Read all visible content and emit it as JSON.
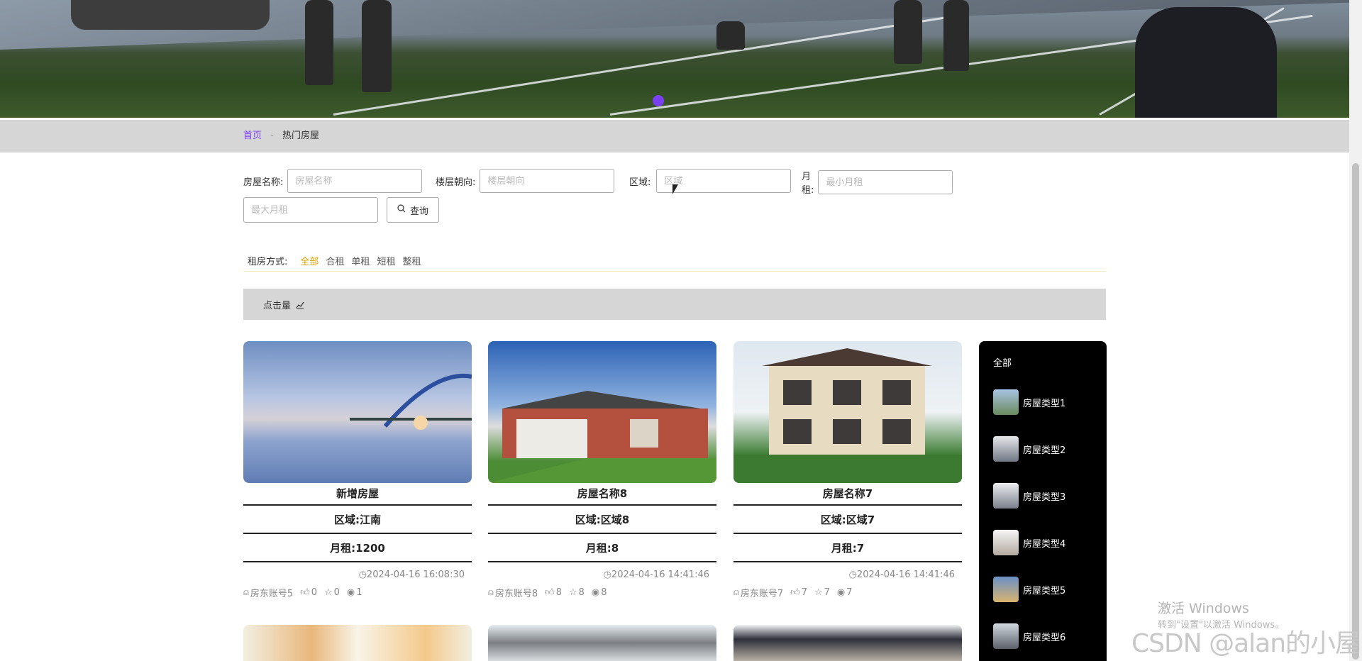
{
  "breadcrumb": {
    "home": "首页",
    "separator": "-",
    "current": "热门房屋"
  },
  "search": {
    "fields": [
      {
        "label": "房屋名称:",
        "placeholder": "房屋名称"
      },
      {
        "label": "楼层朝向:",
        "placeholder": "楼层朝向"
      },
      {
        "label": "区域:",
        "placeholder": "区域"
      },
      {
        "label": "月租:",
        "placeholder": "最小月租"
      },
      {
        "label": "",
        "placeholder": "最大月租"
      }
    ],
    "button_label": "查询"
  },
  "rent_mode": {
    "label": "租房方式:",
    "options": [
      "全部",
      "合租",
      "单租",
      "短租",
      "整租"
    ],
    "active": "全部"
  },
  "sort": {
    "label": "点击量"
  },
  "cards": [
    {
      "title": "新增房屋",
      "area": "区域:江南",
      "rent": "月租:1200",
      "date": "2024-04-16 16:08:30",
      "owner": "房东账号5",
      "likes": "0",
      "stars": "0",
      "views": "1"
    },
    {
      "title": "房屋名称8",
      "area": "区域:区域8",
      "rent": "月租:8",
      "date": "2024-04-16 14:41:46",
      "owner": "房东账号8",
      "likes": "8",
      "stars": "8",
      "views": "8"
    },
    {
      "title": "房屋名称7",
      "area": "区域:区域7",
      "rent": "月租:7",
      "date": "2024-04-16 14:41:46",
      "owner": "房东账号7",
      "likes": "7",
      "stars": "7",
      "views": "7"
    }
  ],
  "side": {
    "all": "全部",
    "items": [
      "房屋类型1",
      "房屋类型2",
      "房屋类型3",
      "房屋类型4",
      "房屋类型5",
      "房屋类型6"
    ]
  },
  "watermark": {
    "line1": "激活 Windows",
    "line2": "转到\"设置\"以激活 Windows。",
    "brand": "CSDN @alan的小屋"
  },
  "colors": {
    "accent": "#7b3ff2",
    "active_option": "#d8a300",
    "bar_gray": "#d6d6d6"
  }
}
